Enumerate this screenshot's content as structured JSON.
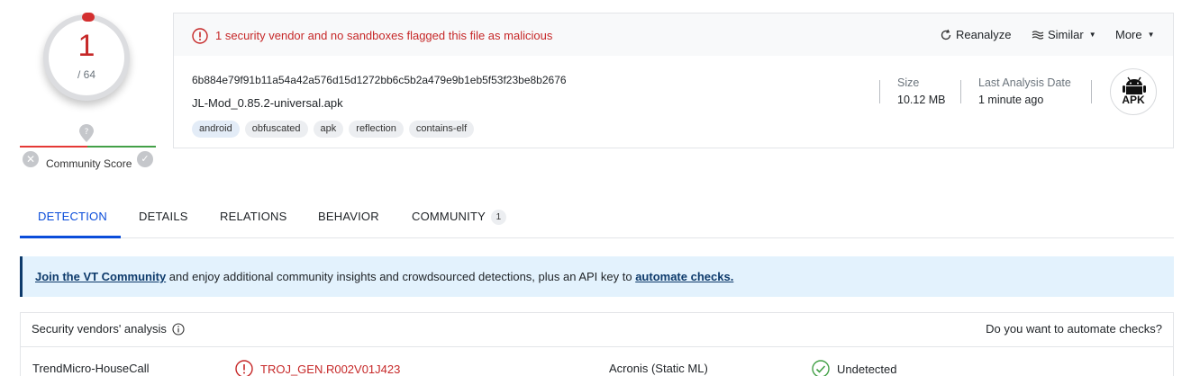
{
  "score": {
    "detections": "1",
    "total": "/ 64",
    "community_label": "Community Score"
  },
  "alert": {
    "message": "1 security vendor and no sandboxes flagged this file as malicious"
  },
  "actions": {
    "reanalyze": "Reanalyze",
    "similar": "Similar",
    "more": "More"
  },
  "file": {
    "hash": "6b884e79f91b11a54a42a576d15d1272bb6c5b2a479e9b1eb5f53f23be8b2676",
    "name": "JL-Mod_0.85.2-universal.apk",
    "tags": [
      "android",
      "obfuscated",
      "apk",
      "reflection",
      "contains-elf"
    ],
    "size_label": "Size",
    "size_value": "10.12 MB",
    "date_label": "Last Analysis Date",
    "date_value": "1 minute ago",
    "type_badge": "APK"
  },
  "tabs": [
    {
      "label": "DETECTION"
    },
    {
      "label": "DETAILS"
    },
    {
      "label": "RELATIONS"
    },
    {
      "label": "BEHAVIOR"
    },
    {
      "label": "COMMUNITY",
      "count": "1"
    }
  ],
  "banner": {
    "link1": "Join the VT Community",
    "middle": " and enjoy additional community insights and crowdsourced detections, plus an API key to ",
    "link2": "automate checks."
  },
  "vendors": {
    "title": "Security vendors' analysis",
    "automate": "Do you want to automate checks?",
    "rows": [
      {
        "vendor1": "TrendMicro-HouseCall",
        "result1": "TROJ_GEN.R002V01J423",
        "vendor2": "Acronis (Static ML)",
        "result2": "Undetected"
      }
    ]
  },
  "colors": {
    "malicious": "#c62828",
    "accent": "#0b4dda",
    "banner_bg": "#e3f2fd",
    "clean": "#43a047"
  }
}
